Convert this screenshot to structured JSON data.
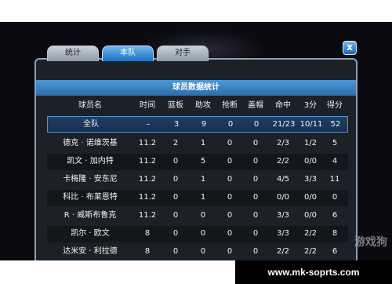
{
  "tabs": [
    {
      "label": "统计",
      "active": false
    },
    {
      "label": "本队",
      "active": true
    },
    {
      "label": "对手",
      "active": false
    }
  ],
  "close_label": "x",
  "title": "球员数据统计",
  "columns": [
    "球员名",
    "时间",
    "篮板",
    "助攻",
    "抢断",
    "盖帽",
    "命中",
    "3分",
    "得分"
  ],
  "total_row": {
    "name": "全队",
    "values": [
      "–",
      "3",
      "9",
      "0",
      "0",
      "21/23",
      "10/11",
      "52"
    ]
  },
  "players": [
    {
      "name": "德克 · 诺维茨基",
      "values": [
        "11.2",
        "2",
        "1",
        "0",
        "0",
        "2/3",
        "1/2",
        "5"
      ]
    },
    {
      "name": "凯文 · 加内特",
      "values": [
        "11.2",
        "0",
        "5",
        "0",
        "0",
        "2/2",
        "0/0",
        "4"
      ]
    },
    {
      "name": "卡梅隆 · 安东尼",
      "values": [
        "11.2",
        "0",
        "1",
        "0",
        "0",
        "4/5",
        "3/3",
        "11"
      ]
    },
    {
      "name": "科比 · 布莱恩特",
      "values": [
        "11.2",
        "0",
        "1",
        "0",
        "0",
        "0/0",
        "0/0",
        "0"
      ]
    },
    {
      "name": "R · 威斯布鲁克",
      "values": [
        "11.2",
        "0",
        "0",
        "0",
        "0",
        "3/3",
        "0/0",
        "6"
      ]
    },
    {
      "name": "凯尔 · 欧文",
      "values": [
        "8",
        "0",
        "0",
        "0",
        "0",
        "3/3",
        "2/2",
        "8"
      ]
    },
    {
      "name": "达米安 · 利拉德",
      "values": [
        "8",
        "0",
        "0",
        "0",
        "0",
        "2/2",
        "2/2",
        "6"
      ]
    }
  ],
  "watermark": "游戏狗",
  "footer": "www.mk-soprts.com",
  "colors": {
    "accent": "#2f7fd0",
    "panel": "#1c2127",
    "total_row": "#1f3f66"
  }
}
